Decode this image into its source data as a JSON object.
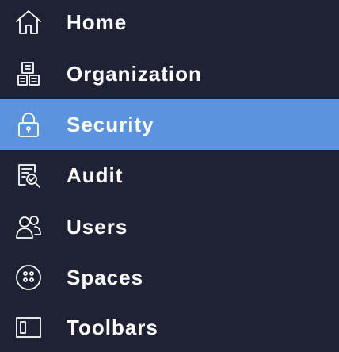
{
  "sidebar": {
    "colors": {
      "background": "#1f2235",
      "active": "#5b93df",
      "text": "#ffffff"
    },
    "items": [
      {
        "label": "Home",
        "icon": "home-icon",
        "active": false
      },
      {
        "label": "Organization",
        "icon": "organization-icon",
        "active": false
      },
      {
        "label": "Security",
        "icon": "lock-icon",
        "active": true
      },
      {
        "label": "Audit",
        "icon": "audit-icon",
        "active": false
      },
      {
        "label": "Users",
        "icon": "users-icon",
        "active": false
      },
      {
        "label": "Spaces",
        "icon": "spaces-icon",
        "active": false
      },
      {
        "label": "Toolbars",
        "icon": "toolbar-icon",
        "active": false
      }
    ]
  }
}
